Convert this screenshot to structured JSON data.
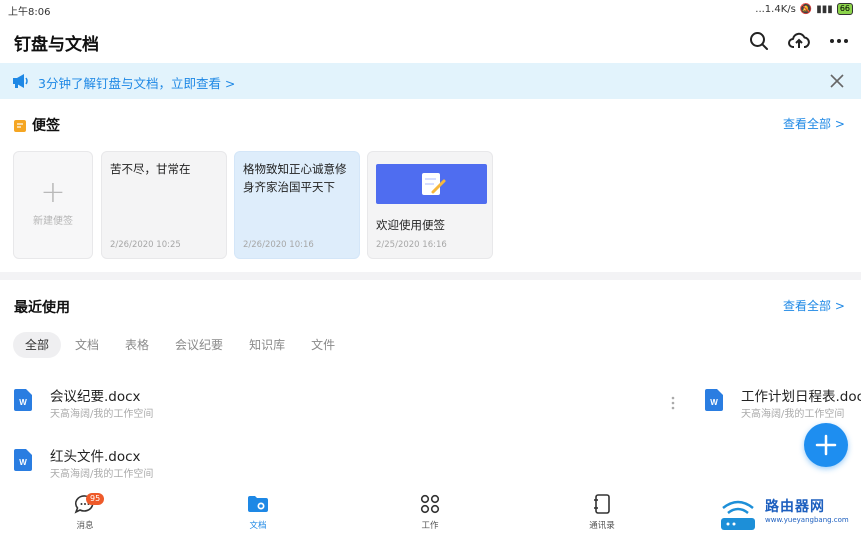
{
  "status_bar": {
    "time": "上午8:06",
    "network_speed": "...1.4K/s",
    "battery": "66"
  },
  "header": {
    "title": "钉盘与文档",
    "icons": [
      "search-icon",
      "cloud-upload-icon",
      "more-icon"
    ]
  },
  "banner": {
    "text": "3分钟了解钉盘与文档，立即查看 >"
  },
  "notes": {
    "title": "便签",
    "view_all": "查看全部 >",
    "new_note_label": "新建便签",
    "items": [
      {
        "text": "苦不尽，甘常在",
        "date": "2/26/2020 10:25"
      },
      {
        "text": "格物致知正心诚意修身齐家治国平天下",
        "date": "2/26/2020 10:16"
      },
      {
        "text": "欢迎使用便签",
        "date": "2/25/2020 16:16"
      }
    ]
  },
  "recent": {
    "title": "最近使用",
    "view_all": "查看全部 >",
    "filters": [
      "全部",
      "文档",
      "表格",
      "会议纪要",
      "知识库",
      "文件"
    ],
    "active_filter": "全部",
    "files": [
      {
        "name": "会议纪要.docx",
        "path": "天高海阔/我的工作空间"
      },
      {
        "name": "工作计划日程表.doc",
        "path": "天高海阔/我的工作空间"
      },
      {
        "name": "红头文件.docx",
        "path": "天高海阔/我的工作空间"
      }
    ]
  },
  "bottom_nav": {
    "items": [
      {
        "label": "消息",
        "icon": "chat-icon",
        "badge": "95"
      },
      {
        "label": "文档",
        "icon": "folder-icon"
      },
      {
        "label": "工作",
        "icon": "grid-icon"
      },
      {
        "label": "通讯录",
        "icon": "contacts-icon"
      }
    ],
    "active": "文档"
  },
  "watermark": {
    "title": "路由器网",
    "url": "www.yueyangbang.com"
  },
  "colors": {
    "accent": "#1e88e5",
    "banner_bg": "#e2f3fc",
    "badge": "#ee5a2a",
    "note_highlight": "#deedfb"
  }
}
